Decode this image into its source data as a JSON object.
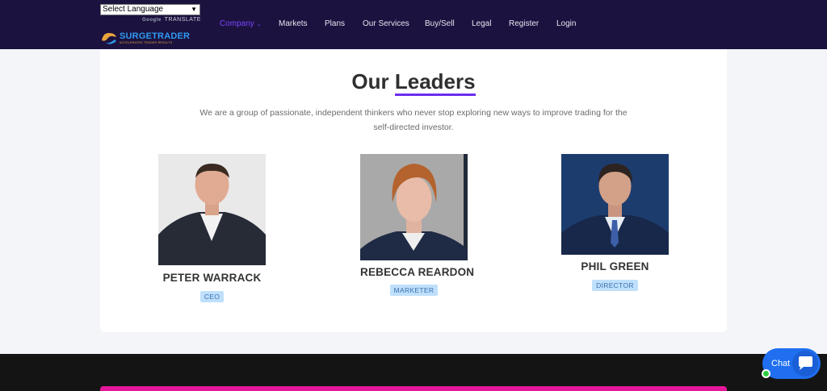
{
  "header": {
    "language_select": "Select Language",
    "powered_by": "Google",
    "translate": "TRANSLATE",
    "logo": {
      "surge": "SURGE",
      "trader": "TRADER",
      "tagline": "ACCELERATED TRADER RESULTS"
    },
    "nav": [
      {
        "label": "Company",
        "active": true,
        "has_dropdown": true
      },
      {
        "label": "Markets"
      },
      {
        "label": "Plans"
      },
      {
        "label": "Our Services"
      },
      {
        "label": "Buy/Sell"
      },
      {
        "label": "Legal"
      },
      {
        "label": "Register"
      },
      {
        "label": "Login"
      }
    ]
  },
  "section": {
    "title_part1": "Our",
    "title_part2": "Leaders",
    "description": "We are a group of passionate, independent thinkers who never stop exploring new ways to improve trading for the self-directed investor."
  },
  "leaders": [
    {
      "name": "PETER WARRACK",
      "role": "CEO"
    },
    {
      "name": "REBECCA REARDON",
      "role": "MARKETER"
    },
    {
      "name": "PHIL GREEN",
      "role": "DIRECTOR"
    }
  ],
  "chat": {
    "label": "Chat"
  },
  "colors": {
    "header_bg": "#1c1240",
    "accent": "#6b2df0",
    "role_badge_bg": "#bfe0fb",
    "footer_bg": "#141414",
    "footer_bar": "#e4179a",
    "chat_bg": "#1f6ff0"
  }
}
